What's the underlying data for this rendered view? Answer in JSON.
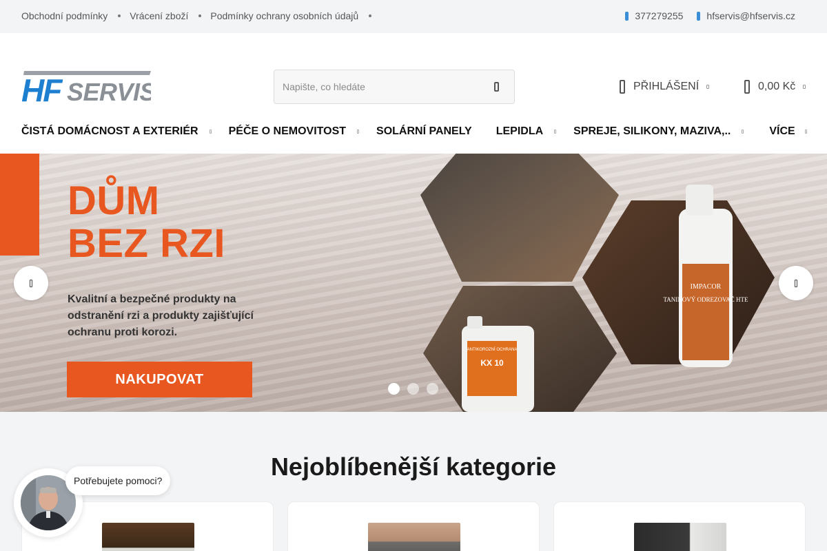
{
  "topbar": {
    "links": [
      "Obchodní podmínky",
      "Vrácení zboží",
      "Podmínky ochrany osobních údajů"
    ],
    "phone": "377279255",
    "email": "hfservis@hfservis.cz"
  },
  "header": {
    "logo_text": "HFSERVIS",
    "search_placeholder": "Napište, co hledáte",
    "login_label": "PŘIHLÁŠENÍ",
    "cart_total": "0,00 Kč"
  },
  "nav": {
    "items": [
      {
        "label": "ČISTÁ DOMÁCNOST A EXTERIÉR",
        "has_dropdown": true
      },
      {
        "label": "PÉČE O NEMOVITOST",
        "has_dropdown": true
      },
      {
        "label": "SOLÁRNÍ PANELY",
        "has_dropdown": false
      },
      {
        "label": "LEPIDLA",
        "has_dropdown": true
      },
      {
        "label": "SPREJE, SILIKONY, MAZIVA,..",
        "has_dropdown": true
      },
      {
        "label": "VÍCE",
        "has_dropdown": true
      }
    ]
  },
  "banner": {
    "heading_line1": "DŮM",
    "heading_line2": "BEZ RZI",
    "description": "Kvalitní a bezpečné produkty na odstranění rzi a produkty zajišťující ochranu proti korozi.",
    "cta_label": "NAKUPOVAT",
    "product1_label": "KX 10",
    "product1_brand": "ANTIKOROZNÍ OCHRANA",
    "product2_label": "TANINOVÝ ODREZOVAČ HTE",
    "product2_brand": "IMPACOR",
    "slides_count": 3,
    "active_slide": 1
  },
  "categories": {
    "title": "Nejoblíbenější kategorie"
  },
  "chat": {
    "bubble_text": "Potřebujete pomoci?"
  },
  "colors": {
    "brand_orange": "#e8571f",
    "logo_blue": "#1d7fd0",
    "accent_blue": "#3a8ed8"
  }
}
